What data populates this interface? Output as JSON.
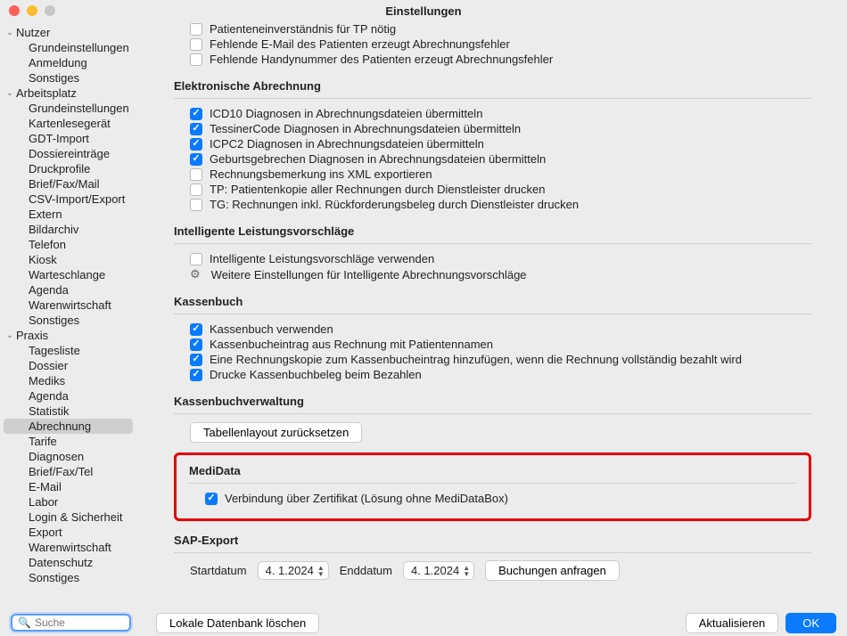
{
  "window": {
    "title": "Einstellungen"
  },
  "sidebar": {
    "groups": [
      {
        "label": "Nutzer",
        "items": [
          "Grundeinstellungen",
          "Anmeldung",
          "Sonstiges"
        ]
      },
      {
        "label": "Arbeitsplatz",
        "items": [
          "Grundeinstellungen",
          "Kartenlesegerät",
          "GDT-Import",
          "Dossiereinträge",
          "Druckprofile",
          "Brief/Fax/Mail",
          "CSV-Import/Export",
          "Extern",
          "Bildarchiv",
          "Telefon",
          "Kiosk",
          "Warteschlange",
          "Agenda",
          "Warenwirtschaft",
          "Sonstiges"
        ]
      },
      {
        "label": "Praxis",
        "items": [
          "Tagesliste",
          "Dossier",
          "Mediks",
          "Agenda",
          "Statistik",
          "Abrechnung",
          "Tarife",
          "Diagnosen",
          "Brief/Fax/Tel",
          "E-Mail",
          "Labor",
          "Login & Sicherheit",
          "Export",
          "Warenwirtschaft",
          "Datenschutz",
          "Sonstiges"
        ]
      }
    ],
    "selected": "Abrechnung"
  },
  "topChecks": [
    {
      "label": "Patienteneinverständnis für TP nötig",
      "checked": false
    },
    {
      "label": "Fehlende E-Mail des Patienten erzeugt Abrechnungsfehler",
      "checked": false
    },
    {
      "label": "Fehlende Handynummer des Patienten erzeugt Abrechnungsfehler",
      "checked": false
    }
  ],
  "sections": {
    "elektronische": {
      "title": "Elektronische Abrechnung",
      "items": [
        {
          "label": "ICD10 Diagnosen in Abrechnungsdateien übermitteln",
          "checked": true
        },
        {
          "label": "TessinerCode Diagnosen in Abrechnungsdateien übermitteln",
          "checked": true
        },
        {
          "label": "ICPC2 Diagnosen in Abrechnungsdateien übermitteln",
          "checked": true
        },
        {
          "label": "Geburtsgebrechen Diagnosen in Abrechnungsdateien übermitteln",
          "checked": true
        },
        {
          "label": "Rechnungsbemerkung ins XML exportieren",
          "checked": false
        },
        {
          "label": "TP: Patientenkopie aller Rechnungen durch Dienstleister drucken",
          "checked": false
        },
        {
          "label": "TG: Rechnungen inkl. Rückforderungsbeleg durch Dienstleister drucken",
          "checked": false
        }
      ]
    },
    "intelligente": {
      "title": "Intelligente Leistungsvorschläge",
      "check": {
        "label": "Intelligente Leistungsvorschläge verwenden",
        "checked": false
      },
      "gearLabel": "Weitere Einstellungen für Intelligente Abrechnungsvorschläge"
    },
    "kassenbuch": {
      "title": "Kassenbuch",
      "items": [
        {
          "label": "Kassenbuch verwenden",
          "checked": true
        },
        {
          "label": "Kassenbucheintrag aus Rechnung mit Patientennamen",
          "checked": true
        },
        {
          "label": "Eine Rechnungskopie zum Kassenbucheintrag hinzufügen, wenn die Rechnung vollständig bezahlt wird",
          "checked": true
        },
        {
          "label": "Drucke Kassenbuchbeleg beim Bezahlen",
          "checked": true
        }
      ]
    },
    "kassenbuchverwaltung": {
      "title": "Kassenbuchverwaltung",
      "button": "Tabellenlayout zurücksetzen"
    },
    "medidata": {
      "title": "MediData",
      "check": {
        "label": "Verbindung über Zertifikat (Lösung ohne MediDataBox)",
        "checked": true
      }
    },
    "sap": {
      "title": "SAP-Export",
      "startLabel": "Startdatum",
      "startValue": "4.   1.2024",
      "endLabel": "Enddatum",
      "endValue": "4.   1.2024",
      "button": "Buchungen anfragen"
    }
  },
  "footer": {
    "searchPlaceholder": "Suche",
    "deleteDb": "Lokale Datenbank löschen",
    "refresh": "Aktualisieren",
    "ok": "OK"
  }
}
